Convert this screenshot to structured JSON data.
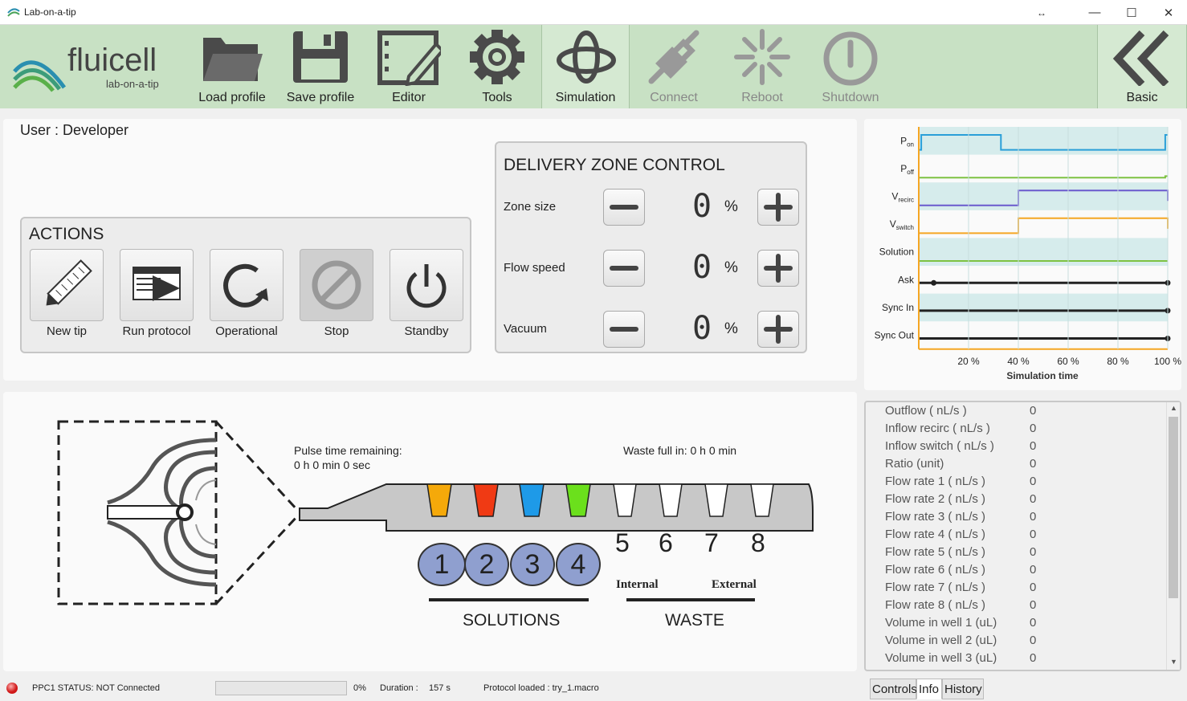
{
  "window": {
    "title": "Lab-on-a-tip"
  },
  "logo": {
    "name": "fluicell",
    "tagline": "lab-on-a-tip"
  },
  "toolbar": {
    "items": [
      {
        "label": "Load profile",
        "icon": "folder-icon"
      },
      {
        "label": "Save profile",
        "icon": "floppy-disk-icon"
      },
      {
        "label": "Editor",
        "icon": "editor-icon"
      },
      {
        "label": "Tools",
        "icon": "gear-icon"
      },
      {
        "label": "Simulation",
        "icon": "simulation-icon"
      },
      {
        "label": "Connect",
        "icon": "plug-icon"
      },
      {
        "label": "Reboot",
        "icon": "reboot-icon"
      },
      {
        "label": "Shutdown",
        "icon": "power-icon"
      }
    ],
    "basic_label": "Basic"
  },
  "user": {
    "label": "User : Developer"
  },
  "actions": {
    "title": "ACTIONS",
    "buttons": [
      "New tip",
      "Run protocol",
      "Operational",
      "Stop",
      "Standby"
    ]
  },
  "delivery": {
    "title": "DELIVERY ZONE CONTROL",
    "rows": [
      {
        "label": "Zone size",
        "value": "0",
        "unit": "%"
      },
      {
        "label": "Flow speed",
        "value": "0",
        "unit": "%"
      },
      {
        "label": "Vacuum",
        "value": "0",
        "unit": "%"
      }
    ]
  },
  "chart_data": {
    "type": "line",
    "xlabel": "Simulation time",
    "x_ticks": [
      "20 %",
      "40 %",
      "60 %",
      "80 %",
      "100 %"
    ],
    "colors": {
      "band": "#d6ecec",
      "pon": "#2a9fd8",
      "poff": "#7dc242",
      "vrecirc": "#6a5acd",
      "vswitch": "#f5a623",
      "solution": "#7dc242",
      "black": "#222222"
    },
    "series": [
      {
        "name": "Pon",
        "main": "P",
        "sub": "on",
        "color": "#2a9fd8",
        "points": [
          [
            0,
            0
          ],
          [
            1,
            0
          ],
          [
            1,
            1
          ],
          [
            33,
            1
          ],
          [
            33,
            0
          ],
          [
            99,
            0
          ],
          [
            99,
            1
          ],
          [
            100,
            1
          ]
        ]
      },
      {
        "name": "Poff",
        "main": "P",
        "sub": "off",
        "color": "#7dc242",
        "points": [
          [
            0,
            0
          ],
          [
            99,
            0
          ],
          [
            99,
            0.1
          ],
          [
            100,
            0.1
          ]
        ]
      },
      {
        "name": "Vrecirc",
        "main": "V",
        "sub": "recirc",
        "color": "#6a5acd",
        "points": [
          [
            0,
            0
          ],
          [
            40,
            0
          ],
          [
            40,
            1
          ],
          [
            100,
            1
          ],
          [
            100,
            0.3
          ]
        ]
      },
      {
        "name": "Vswitch",
        "main": "V",
        "sub": "switch",
        "color": "#f5a623",
        "points": [
          [
            0,
            0
          ],
          [
            40,
            0
          ],
          [
            40,
            1
          ],
          [
            100,
            1
          ],
          [
            100,
            0.3
          ]
        ]
      },
      {
        "name": "Solution",
        "main": "Solution",
        "sub": "",
        "color": "#7dc242",
        "points": [
          [
            0,
            0
          ],
          [
            100,
            0
          ]
        ]
      },
      {
        "name": "Ask",
        "main": "Ask",
        "sub": "",
        "color": "#222222",
        "points": [
          [
            0,
            0
          ],
          [
            100,
            0
          ]
        ],
        "dots": [
          6,
          100
        ]
      },
      {
        "name": "Sync In",
        "main": "Sync In",
        "sub": "",
        "color": "#222222",
        "points": [
          [
            0,
            0
          ],
          [
            100,
            0
          ]
        ],
        "dots": [
          100
        ]
      },
      {
        "name": "Sync Out",
        "main": "Sync Out",
        "sub": "",
        "color": "#222222",
        "points": [
          [
            0,
            0
          ],
          [
            100,
            0
          ]
        ],
        "dots": [
          100
        ]
      }
    ]
  },
  "tip": {
    "pulse_label": "Pulse time remaining:",
    "pulse_value": "0 h 0 min 0 sec",
    "waste_label": "Waste full in: 0 h 0 min",
    "well_colors": [
      "#f5a90a",
      "#f03a14",
      "#1e9ae8",
      "#6be01c"
    ],
    "solutions": [
      "1",
      "2",
      "3",
      "4"
    ],
    "wastes": [
      "5",
      "6",
      "7",
      "8"
    ],
    "internal": "Internal",
    "external": "External",
    "solutions_title": "SOLUTIONS",
    "waste_title": "WASTE"
  },
  "info": {
    "rows": [
      {
        "k": "Outflow ( nL/s )",
        "v": "0"
      },
      {
        "k": "Inflow recirc ( nL/s )",
        "v": "0"
      },
      {
        "k": "Inflow switch ( nL/s )",
        "v": "0"
      },
      {
        "k": "Ratio (unit)",
        "v": "0"
      },
      {
        "k": "Flow rate 1 ( nL/s )",
        "v": "0"
      },
      {
        "k": "Flow rate 2 ( nL/s )",
        "v": "0"
      },
      {
        "k": "Flow rate 3 ( nL/s )",
        "v": "0"
      },
      {
        "k": "Flow rate 4 ( nL/s )",
        "v": "0"
      },
      {
        "k": "Flow rate 5 ( nL/s )",
        "v": "0"
      },
      {
        "k": "Flow rate 6 ( nL/s )",
        "v": "0"
      },
      {
        "k": "Flow rate 7 ( nL/s )",
        "v": "0"
      },
      {
        "k": "Flow rate 8 ( nL/s )",
        "v": "0"
      },
      {
        "k": "Volume in well 1 (uL)",
        "v": "0"
      },
      {
        "k": "Volume in well 2 (uL)",
        "v": "0"
      },
      {
        "k": "Volume in well 3 (uL)",
        "v": "0"
      }
    ]
  },
  "tabs": [
    "Controls",
    "Info",
    "History"
  ],
  "status": {
    "connection": "PPC1 STATUS: NOT Connected",
    "progress": 0,
    "progress_text": "0%",
    "duration_label": "Duration :",
    "duration_value": "157 s",
    "protocol": "Protocol loaded : try_1.macro"
  }
}
